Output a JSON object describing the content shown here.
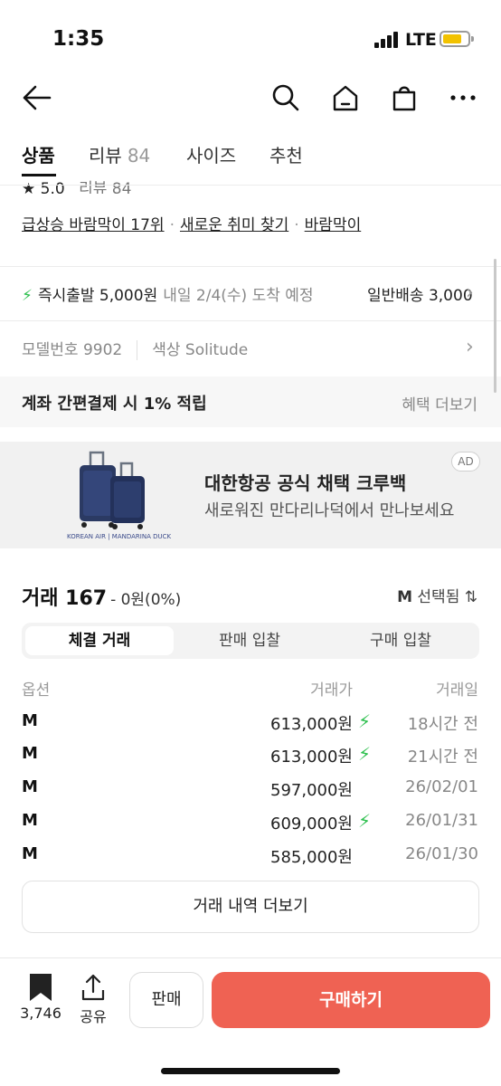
{
  "status": {
    "time": "1:35",
    "network": "LTE"
  },
  "nav": {
    "back_icon": "arrow-left-icon",
    "icons": [
      "search-icon",
      "home-icon",
      "shopping-bag-icon",
      "more-icon"
    ]
  },
  "tabs": [
    {
      "label": "상품"
    },
    {
      "label": "리뷰",
      "count": "84"
    },
    {
      "label": "사이즈"
    },
    {
      "label": "추천"
    }
  ],
  "rating": {
    "score": "5.0",
    "review": "리뷰 84"
  },
  "rank_links": [
    "급상승 바람막이 17위",
    "새로운 취미 찾기",
    "바람막이"
  ],
  "shipping": {
    "express_label": "즉시출발 5,000원",
    "express_eta": "내일 2/4(수) 도착 예정",
    "normal_label": "일반배송 3,000"
  },
  "model": {
    "number": "모델번호 9902",
    "color": "색상 Solitude"
  },
  "benefit": {
    "text": "계좌 간편결제 시 1% 적립",
    "more": "혜택 더보기"
  },
  "ad": {
    "title": "대한항공 공식 채택 크루백",
    "subtitle": "새로워진 만다리나덕에서 만나보세요",
    "badge": "AD",
    "brand_text": "KOREAN AIR | MANDARINA DUCK"
  },
  "trades": {
    "title": "거래 167",
    "change": "- 0원(0%)",
    "size_selected": "M",
    "size_label": "선택됨",
    "segments": [
      "체결 거래",
      "판매 입찰",
      "구매 입찰"
    ],
    "active_segment": 0,
    "columns": [
      "옵션",
      "거래가",
      "거래일"
    ],
    "rows": [
      {
        "option": "M",
        "price": "613,000원",
        "express": true,
        "date": "18시간 전"
      },
      {
        "option": "M",
        "price": "613,000원",
        "express": true,
        "date": "21시간 전"
      },
      {
        "option": "M",
        "price": "597,000원",
        "express": false,
        "date": "26/02/01"
      },
      {
        "option": "M",
        "price": "609,000원",
        "express": true,
        "date": "26/01/31"
      },
      {
        "option": "M",
        "price": "585,000원",
        "express": false,
        "date": "26/01/30"
      }
    ],
    "more_button": "거래 내역 더보기"
  },
  "bottom_bar": {
    "bookmark_count": "3,746",
    "share_label": "공유",
    "sell_label": "판매",
    "buy_label": "구매하기"
  },
  "colors": {
    "accent": "#ef6253",
    "express": "#2ec04f"
  }
}
